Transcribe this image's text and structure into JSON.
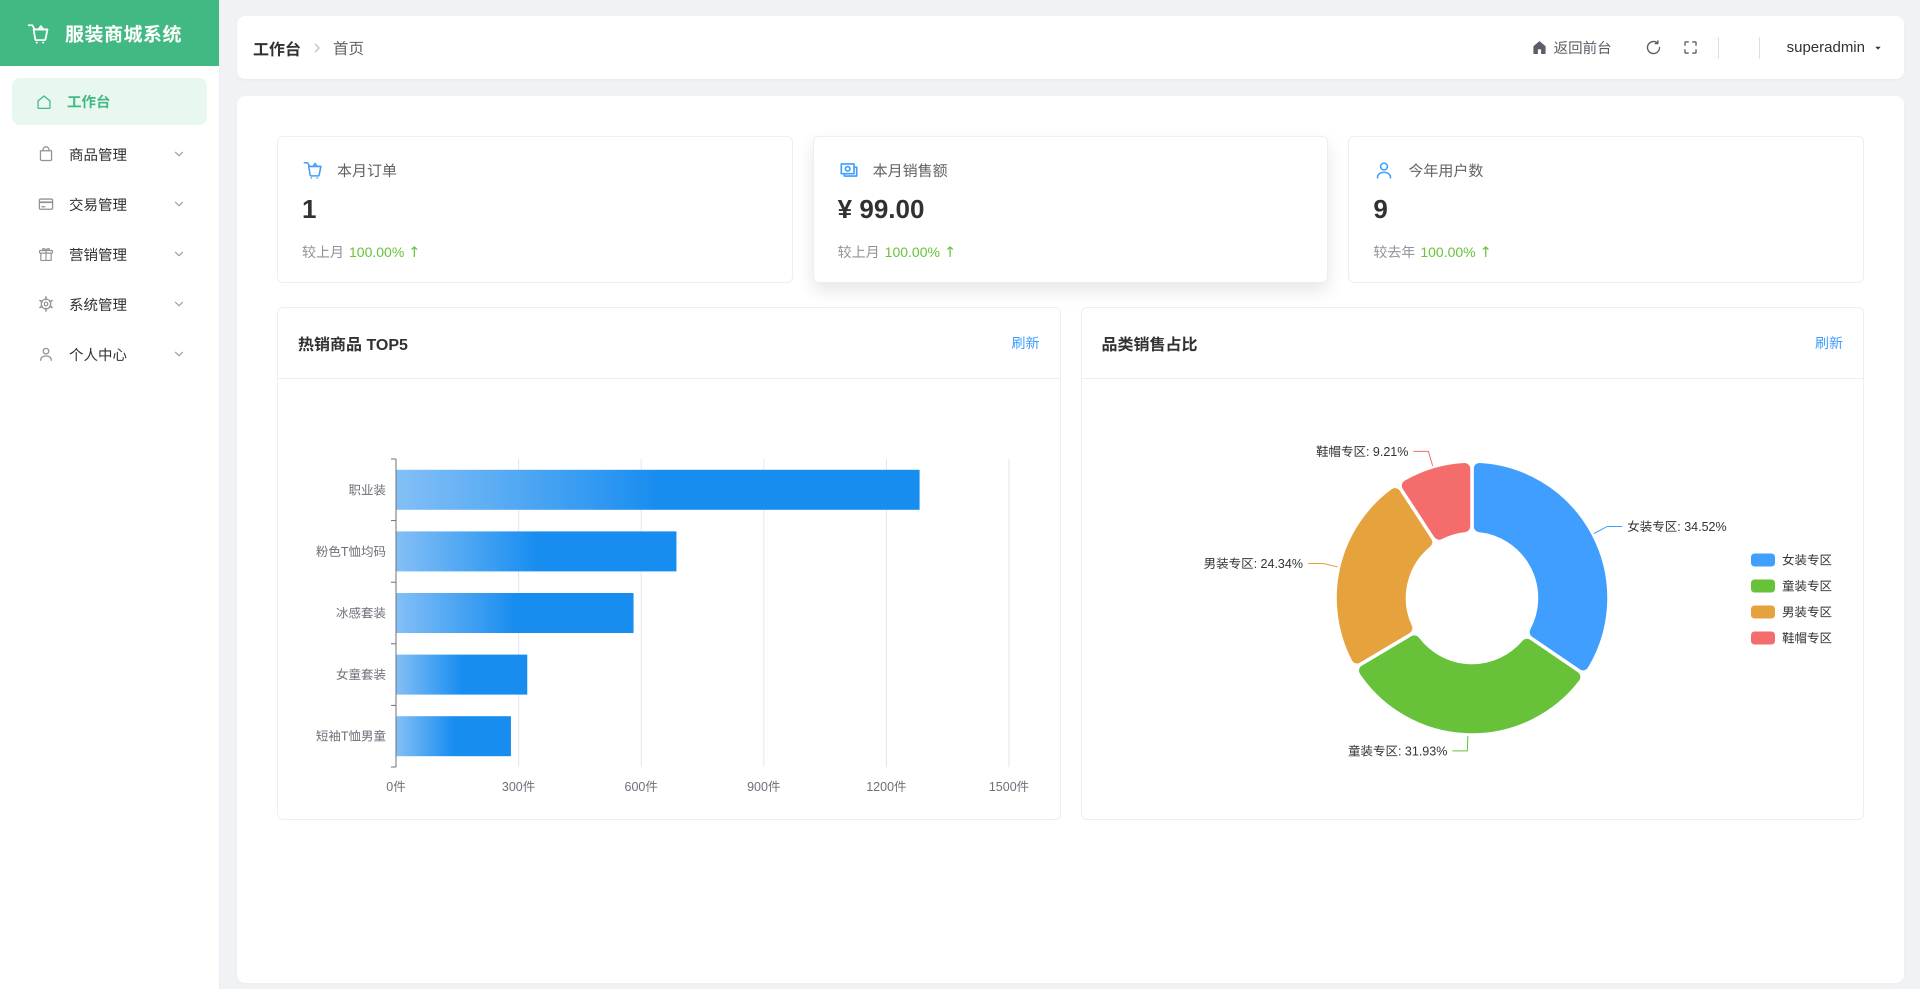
{
  "app": {
    "title": "服装商城系统"
  },
  "sidebar": {
    "items": [
      {
        "label": "工作台",
        "icon": "house-icon",
        "active": true,
        "has_children": false
      },
      {
        "label": "商品管理",
        "icon": "shopping-bag-icon",
        "active": false,
        "has_children": true
      },
      {
        "label": "交易管理",
        "icon": "credit-card-icon",
        "active": false,
        "has_children": true
      },
      {
        "label": "营销管理",
        "icon": "gift-icon",
        "active": false,
        "has_children": true
      },
      {
        "label": "系统管理",
        "icon": "gear-icon",
        "active": false,
        "has_children": true
      },
      {
        "label": "个人中心",
        "icon": "user-icon",
        "active": false,
        "has_children": true
      }
    ]
  },
  "topbar": {
    "breadcrumb": {
      "root": "工作台",
      "page": "首页"
    },
    "back_to_front_label": "返回前台",
    "username": "superadmin"
  },
  "stats": [
    {
      "icon": "shopping-cart-icon",
      "label": "本月订单",
      "value": "1",
      "compare_label": "较上月",
      "percent": "100.00%",
      "trend": "up",
      "arrow": "↑"
    },
    {
      "icon": "money-icon",
      "label": "本月销售额",
      "value": "¥ 99.00",
      "compare_label": "较上月",
      "percent": "100.00%",
      "trend": "up",
      "arrow": "↑"
    },
    {
      "icon": "user-icon",
      "label": "今年用户数",
      "value": "9",
      "compare_label": "较去年",
      "percent": "100.00%",
      "trend": "up",
      "arrow": "↑"
    }
  ],
  "colors": {
    "brand_green": "#42b983",
    "active_menu_bg": "#e8f7ef",
    "link_blue": "#409eff",
    "stat_icon_blue": "#409eff",
    "trend_up_green": "#67c23a",
    "page_bg": "#f0f2f5",
    "axis_text": "#6E7079",
    "grid_line": "#E0E6F1",
    "pie_label_text": "#333333"
  },
  "chart_data": [
    {
      "type": "bar",
      "title": "热销商品 TOP5",
      "refresh_label": "刷新",
      "orientation": "horizontal",
      "categories": [
        "职业装",
        "粉色T恤均码",
        "冰感套装",
        "女童套装",
        "短袖T恤男童"
      ],
      "values": [
        1280,
        685,
        580,
        320,
        280
      ],
      "unit": "件",
      "xlabel": "",
      "ylabel": "",
      "xlim": [
        0,
        1500
      ],
      "xtick_interval": 300,
      "grid": true,
      "bar_gradient": [
        "#83bff6",
        "#188df0",
        "#188df0"
      ]
    },
    {
      "type": "donut",
      "title": "品类销售占比",
      "refresh_label": "刷新",
      "series": [
        {
          "name": "女装专区",
          "percent": 34.52,
          "color": "#409EFF"
        },
        {
          "name": "童装专区",
          "percent": 31.93,
          "color": "#67C23A"
        },
        {
          "name": "男装专区",
          "percent": 24.34,
          "color": "#E6A23C"
        },
        {
          "name": "鞋帽专区",
          "percent": 9.21,
          "color": "#F56C6C"
        }
      ],
      "label_format": "{name}: {percent}%",
      "legend": [
        "女装专区",
        "童装专区",
        "男装专区",
        "鞋帽专区"
      ],
      "legend_position": "right"
    }
  ]
}
